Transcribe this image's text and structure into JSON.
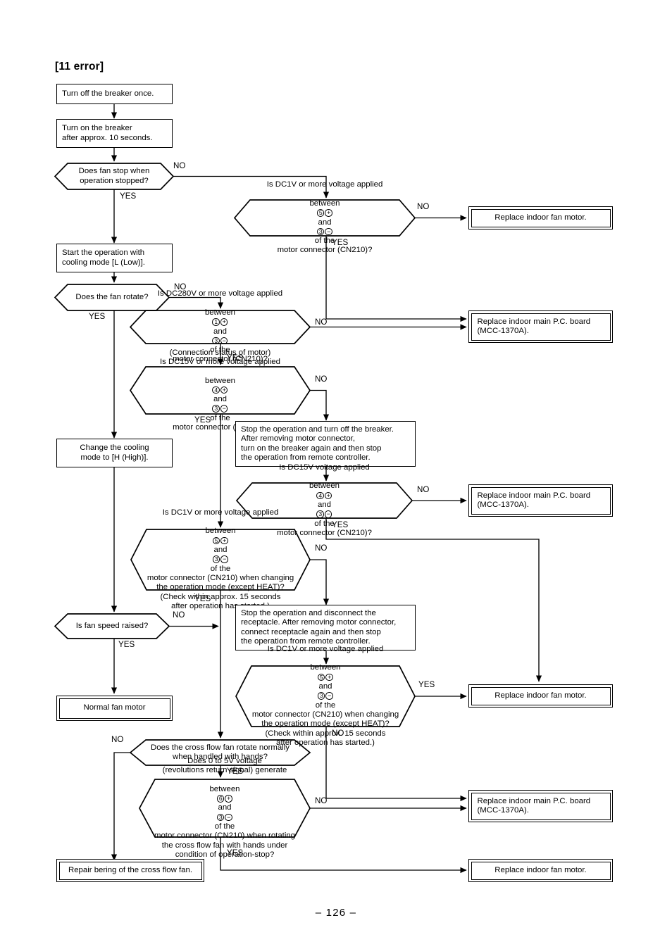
{
  "document": {
    "title": "[11 error]",
    "page_number": "– 126 –"
  },
  "nodes": {
    "n1_turn_off_breaker": "Turn off the breaker once.",
    "n2_turn_on_breaker": "Turn on the breaker\nafter approx. 10 seconds.",
    "n3_does_fan_stop": "Does fan stop when\noperation stopped?",
    "n4_dc1v_5_3": {
      "line1": "Is DC1V or more voltage applied",
      "line2_a": "between",
      "pin_plus": "5",
      "line2_b": "and",
      "pin_minus": "3",
      "line2_c": "of the",
      "line3": "motor connector (CN210)?"
    },
    "n5_replace_fan_motor_1": "Replace indoor fan motor.",
    "n6_start_cooling_low": "Start the operation with\ncooling mode [L (Low)].",
    "n7_does_fan_rotate": "Does the fan rotate?",
    "n8_dc280v_1_3": {
      "line1": "Is DC280V or more voltage applied",
      "line2_a": "between",
      "pin_plus": "1",
      "line2_b": "and",
      "pin_minus": "3",
      "line2_c": "of the",
      "line3": "motor connector (CN210)?"
    },
    "n9_replace_pcb_1": "Replace indoor main P.C. board\n(MCC-1370A).",
    "n10_dc15v_conn_status": {
      "line0": "(Connection status of motor)",
      "line1": "Is DC15V or more voltage applied",
      "line2_a": "between",
      "pin_plus": "4",
      "line2_b": "and",
      "pin_minus": "3",
      "line2_c": "of the",
      "line3": "motor connector (CN210)?"
    },
    "n11_change_cooling_high": "Change the cooling\nmode to [H (High)].",
    "n12_stop_op_breaker": "Stop the operation and turn off the breaker.\nAfter removing motor connector,\nturn on the breaker again and then stop\nthe operation from remote controller.",
    "n13_dc15v_applied": {
      "line1": "Is DC15V voltage applied",
      "line2_a": "between",
      "pin_plus": "4",
      "line2_b": "and",
      "pin_minus": "3",
      "line2_c": "of the",
      "line3": "motor connector (CN210)?"
    },
    "n14_replace_pcb_2": "Replace indoor main P.C. board\n(MCC-1370A).",
    "n15_dc1v_mode_change_a": {
      "line1": "Is DC1V or more voltage applied",
      "line2_a": "between",
      "pin_plus": "5",
      "line2_b": "and",
      "pin_minus": "3",
      "line2_c": "of the",
      "line3": "motor connector (CN210) when changing",
      "line4": "the operation mode (except HEAT)?",
      "line5": "(Check within approx. 15 seconds",
      "line6": "after operation has started.)"
    },
    "n16_is_fan_speed_raised": "Is fan speed raised?",
    "n17_stop_op_receptacle": "Stop the operation and disconnect the\nreceptacle. After removing motor connector,\nconnect receptacle again and then stop\nthe operation from remote controller.",
    "n18_normal_fan_motor": "Normal fan motor",
    "n19_dc1v_mode_change_b": {
      "line1": "Is DC1V or more voltage applied",
      "line2_a": "between",
      "pin_plus": "5",
      "line2_b": "and",
      "pin_minus": "3",
      "line2_c": "of the",
      "line3": "motor connector (CN210) when changing",
      "line4": "the operation mode (except HEAT)?",
      "line5": "(Check within approx. 15 seconds",
      "line6": "after operation has started.)"
    },
    "n20_replace_fan_motor_2": "Replace indoor fan motor.",
    "n21_cross_flow_rotate": "Does the cross flow fan rotate normally\nwhen handled with hands?",
    "n22_revolutions_signal": {
      "line1": "Does 0 to 5V voltage",
      "line2": "(revolutions return signal) generate",
      "line3_a": "between",
      "pin_plus": "6",
      "line3_b": "and",
      "pin_minus": "3",
      "line3_c": "of the",
      "line4": "motor connector (CN210) when rotating",
      "line5": "the cross flow fan with hands under",
      "line6": "condition of operation-stop?"
    },
    "n23_replace_pcb_3": "Replace indoor main P.C. board\n(MCC-1370A).",
    "n24_repair_bearing": "Repair bering of the cross flow fan.",
    "n25_replace_fan_motor_3": "Replace indoor fan motor."
  },
  "branch_labels": {
    "b1_no": "NO",
    "b1_yes": "YES",
    "b2_no": "NO",
    "b2_yes": "YES",
    "b3_no": "NO",
    "b3_yes": "YES",
    "b4_no": "NO",
    "b4_yes": "YES",
    "b5_no": "NO",
    "b5_yes": "YES",
    "b6_no": "NO",
    "b6_yes": "YES",
    "b7_no": "NO",
    "b7_yes": "YES",
    "b8_no": "NO",
    "b8_yes": "YES",
    "b9_no": "NO",
    "b9_yes": "YES",
    "b10_no": "NO",
    "b10_yes": "YES",
    "b11_no": "NO",
    "b11_yes": "YES"
  },
  "signs": {
    "plus": "+",
    "minus": "−"
  },
  "colors": {
    "line": "#000000",
    "background": "#ffffff",
    "text": "#000000"
  }
}
